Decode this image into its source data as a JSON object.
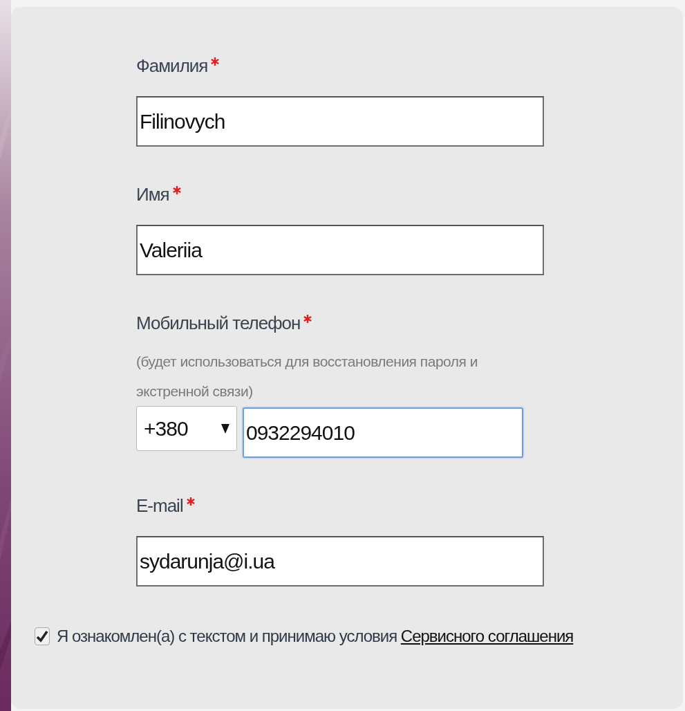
{
  "form": {
    "fields": [
      {
        "kind": "text",
        "label": "Фамилия",
        "required": true,
        "value": "Filinovych",
        "focused": false
      },
      {
        "kind": "text",
        "label": "Имя",
        "required": true,
        "value": "Valeriia",
        "focused": false
      },
      {
        "kind": "phone",
        "label": "Мобильный телефон",
        "required": true,
        "hint": "(будет использоваться для восстановления пароля и экстренной связи)",
        "code": "+380",
        "value": "0932294010",
        "focused": true
      },
      {
        "kind": "text",
        "label": "E-mail",
        "required": true,
        "value": "sydarunja@i.ua",
        "focused": false
      }
    ],
    "agreement": {
      "checked": true,
      "text": "Я ознакомлен(а) с текстом и принимаю условия",
      "link": "Сервисного соглашения"
    }
  }
}
